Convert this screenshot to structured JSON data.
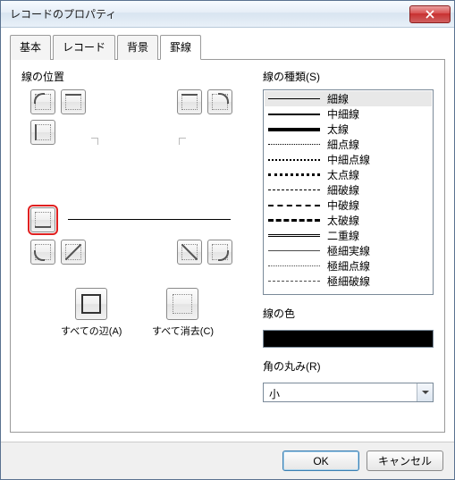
{
  "window": {
    "title": "レコードのプロパティ"
  },
  "tabs": [
    {
      "label": "基本"
    },
    {
      "label": "レコード"
    },
    {
      "label": "背景"
    },
    {
      "label": "罫線",
      "active": true
    }
  ],
  "left": {
    "section_label": "線の位置",
    "all_sides_label": "すべての辺(A)",
    "clear_all_label": "すべて消去(C)"
  },
  "right": {
    "line_types_label": "線の種類(S)",
    "types": [
      {
        "name": "細線",
        "cls": "ls-thin",
        "selected": true
      },
      {
        "name": "中細線",
        "cls": "ls-med"
      },
      {
        "name": "太線",
        "cls": "ls-thick"
      },
      {
        "name": "細点線",
        "cls": "ls-dot"
      },
      {
        "name": "中細点線",
        "cls": "ls-meddot"
      },
      {
        "name": "太点線",
        "cls": "ls-thickdot"
      },
      {
        "name": "細破線",
        "cls": "ls-dash"
      },
      {
        "name": "中破線",
        "cls": "ls-meddash"
      },
      {
        "name": "太破線",
        "cls": "ls-thickdash"
      },
      {
        "name": "二重線",
        "cls": "ls-double"
      },
      {
        "name": "極細実線",
        "cls": "ls-xthin"
      },
      {
        "name": "極細点線",
        "cls": "ls-xthindot"
      },
      {
        "name": "極細破線",
        "cls": "ls-xthindash"
      }
    ],
    "color_label": "線の色",
    "color_value": "#000000",
    "corner_label": "角の丸み(R)",
    "corner_value": "小"
  },
  "footer": {
    "ok": "OK",
    "cancel": "キャンセル"
  }
}
